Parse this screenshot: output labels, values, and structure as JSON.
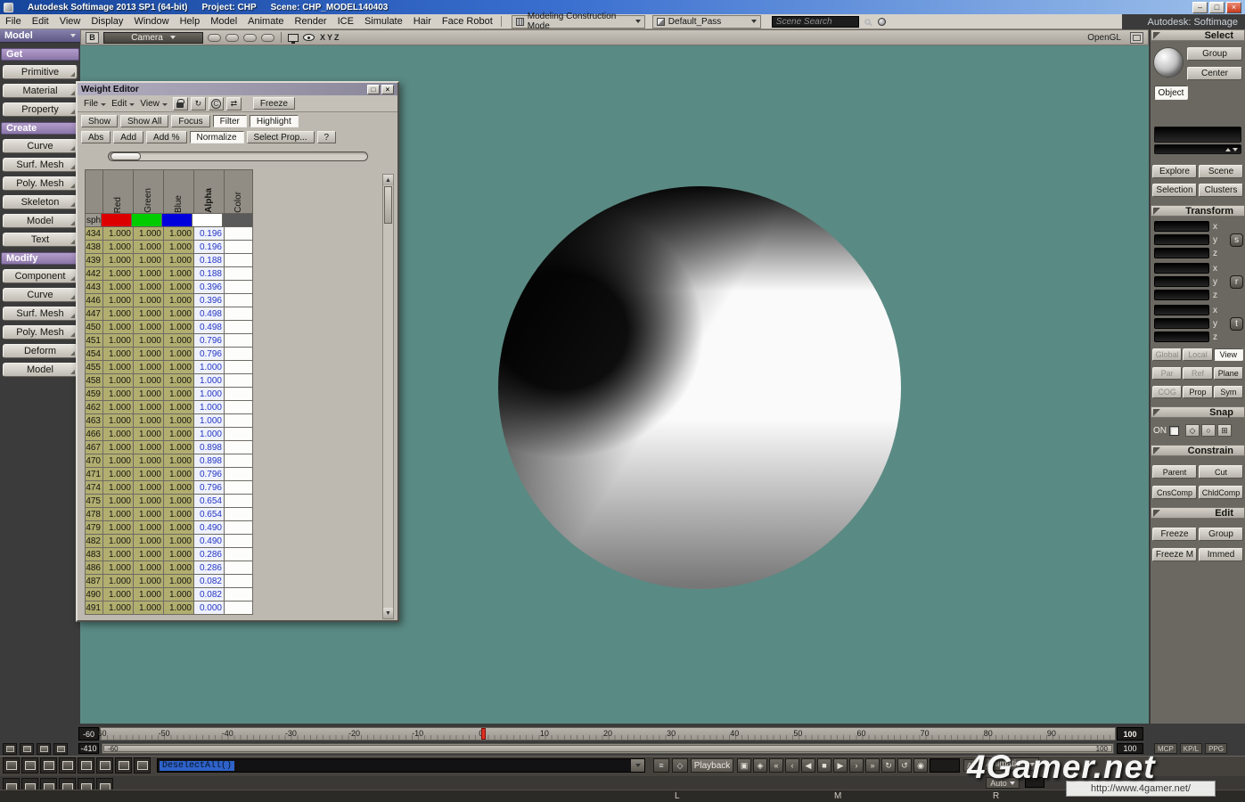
{
  "titlebar": {
    "title": "Autodesk Softimage 2013 SP1 (64-bit)",
    "project": "Project: CHP",
    "scene": "Scene: CHP_MODEL140403",
    "window_buttons": [
      {
        "g": "–",
        "n": "minimize-button"
      },
      {
        "g": "□",
        "n": "maximize-button"
      },
      {
        "g": "×",
        "n": "close-button",
        "cls": "close"
      }
    ]
  },
  "menubar": {
    "items": [
      "File",
      "Edit",
      "View",
      "Display",
      "Window",
      "Help",
      "Model",
      "Animate",
      "Render",
      "ICE",
      "Simulate",
      "Hair",
      "Face Robot"
    ],
    "construction_mode": "Modeling Construction Mode",
    "pass": "Default_Pass",
    "search_text": "Scene Search",
    "brand": "Autodesk: Softimage"
  },
  "left_panel": {
    "mode": "Model",
    "get_header": "Get",
    "get_items": [
      "Primitive",
      "Material",
      "Property"
    ],
    "create_header": "Create",
    "create_items": [
      "Curve",
      "Surf. Mesh",
      "Poly. Mesh",
      "Skeleton",
      "Model",
      "Text"
    ],
    "modify_header": "Modify",
    "modify_items": [
      "Component",
      "Curve",
      "Surf. Mesh",
      "Poly. Mesh",
      "Deform",
      "Model"
    ]
  },
  "viewport": {
    "pane_letter": "B",
    "camera": "Camera",
    "axes": [
      "X",
      "Y",
      "Z"
    ],
    "renderer": "OpenGL"
  },
  "weight_editor": {
    "title": "Weight Editor",
    "window_buttons": [
      {
        "g": "□",
        "n": "restore-button"
      },
      {
        "g": "×",
        "n": "close-button"
      }
    ],
    "menus": [
      "File",
      "Edit",
      "View"
    ],
    "glyphs": {
      "refresh": "↻",
      "swap": "⇄",
      "c_badge": "C",
      "up": "▲",
      "down": "▼"
    },
    "freeze": "Freeze",
    "toggles": [
      {
        "label": "Show"
      },
      {
        "label": "Show All"
      },
      {
        "label": "Focus"
      },
      {
        "label": "Filter",
        "cls": "active"
      },
      {
        "label": "Highlight",
        "cls": "active"
      }
    ],
    "modes": [
      {
        "label": "Abs"
      },
      {
        "label": "Add"
      },
      {
        "label": "Add %"
      },
      {
        "label": "Normalize",
        "cls": "active"
      },
      {
        "label": "Select Prop..."
      },
      {
        "label": "?"
      }
    ],
    "columns": [
      "Red",
      "Green",
      "Blue",
      "Alpha",
      "Color"
    ],
    "object_name": "sphe",
    "swatches": [
      "#dd0000",
      "#00cc00",
      "#0000dd",
      "#ffffff",
      "#5a5a5a"
    ],
    "rows": [
      [
        "434",
        "1.000",
        "1.000",
        "1.000",
        "0.196"
      ],
      [
        "438",
        "1.000",
        "1.000",
        "1.000",
        "0.196"
      ],
      [
        "439",
        "1.000",
        "1.000",
        "1.000",
        "0.188"
      ],
      [
        "442",
        "1.000",
        "1.000",
        "1.000",
        "0.188"
      ],
      [
        "443",
        "1.000",
        "1.000",
        "1.000",
        "0.396"
      ],
      [
        "446",
        "1.000",
        "1.000",
        "1.000",
        "0.396"
      ],
      [
        "447",
        "1.000",
        "1.000",
        "1.000",
        "0.498"
      ],
      [
        "450",
        "1.000",
        "1.000",
        "1.000",
        "0.498"
      ],
      [
        "451",
        "1.000",
        "1.000",
        "1.000",
        "0.796"
      ],
      [
        "454",
        "1.000",
        "1.000",
        "1.000",
        "0.796"
      ],
      [
        "455",
        "1.000",
        "1.000",
        "1.000",
        "1.000"
      ],
      [
        "458",
        "1.000",
        "1.000",
        "1.000",
        "1.000"
      ],
      [
        "459",
        "1.000",
        "1.000",
        "1.000",
        "1.000"
      ],
      [
        "462",
        "1.000",
        "1.000",
        "1.000",
        "1.000"
      ],
      [
        "463",
        "1.000",
        "1.000",
        "1.000",
        "1.000"
      ],
      [
        "466",
        "1.000",
        "1.000",
        "1.000",
        "1.000"
      ],
      [
        "467",
        "1.000",
        "1.000",
        "1.000",
        "0.898"
      ],
      [
        "470",
        "1.000",
        "1.000",
        "1.000",
        "0.898"
      ],
      [
        "471",
        "1.000",
        "1.000",
        "1.000",
        "0.796"
      ],
      [
        "474",
        "1.000",
        "1.000",
        "1.000",
        "0.796"
      ],
      [
        "475",
        "1.000",
        "1.000",
        "1.000",
        "0.654"
      ],
      [
        "478",
        "1.000",
        "1.000",
        "1.000",
        "0.654"
      ],
      [
        "479",
        "1.000",
        "1.000",
        "1.000",
        "0.490"
      ],
      [
        "482",
        "1.000",
        "1.000",
        "1.000",
        "0.490"
      ],
      [
        "483",
        "1.000",
        "1.000",
        "1.000",
        "0.286"
      ],
      [
        "486",
        "1.000",
        "1.000",
        "1.000",
        "0.286"
      ],
      [
        "487",
        "1.000",
        "1.000",
        "1.000",
        "0.082"
      ],
      [
        "490",
        "1.000",
        "1.000",
        "1.000",
        "0.082"
      ],
      [
        "491",
        "1.000",
        "1.000",
        "1.000",
        "0.000"
      ]
    ]
  },
  "right_panel": {
    "select_header": "Select",
    "group": "Group",
    "center": "Center",
    "object": "Object",
    "explore": "Explore",
    "scene": "Scene",
    "selection": "Selection",
    "clusters": "Clusters",
    "transform_header": "Transform",
    "transform_clusters": [
      {
        "axes": [
          "x",
          "y",
          "z"
        ],
        "btn": "s"
      },
      {
        "axes": [
          "x",
          "y",
          "z"
        ],
        "btn": "r"
      },
      {
        "axes": [
          "x",
          "y",
          "z"
        ],
        "btn": "t"
      }
    ],
    "space_buttons": [
      {
        "label": "Global",
        "cls": "disabled"
      },
      {
        "label": "Local",
        "cls": "disabled"
      },
      {
        "label": "View",
        "cls": "active"
      }
    ],
    "ref_buttons": [
      {
        "label": "Par",
        "cls": "disabled"
      },
      {
        "label": "Ref",
        "cls": "disabled"
      },
      {
        "label": "Plane"
      }
    ],
    "extra_buttons": [
      {
        "label": "COG",
        "cls": "disabled"
      },
      {
        "label": "Prop"
      },
      {
        "label": "Sym"
      }
    ],
    "snap_header": "Snap",
    "snap_on": "ON",
    "snap_icons": [
      {
        "g": "◇",
        "n": "snap-point-icon"
      },
      {
        "g": "○",
        "n": "snap-curve-icon"
      },
      {
        "g": "⊞",
        "n": "snap-grid-icon"
      }
    ],
    "constrain_header": "Constrain",
    "constrain_buttons": [
      {
        "label": "Parent"
      },
      {
        "label": "Cut"
      },
      {
        "label": "CnsComp"
      },
      {
        "label": "ChldComp"
      }
    ],
    "edit_header": "Edit",
    "edit_buttons": [
      {
        "label": "Freeze"
      },
      {
        "label": "Group"
      },
      {
        "label": "Freeze M"
      },
      {
        "label": "Immed"
      }
    ]
  },
  "timeline": {
    "start_frame": "-60",
    "end_frame": "100",
    "ticks": [
      "-60",
      "-50",
      "-40",
      "-30",
      "-20",
      "-10",
      "0",
      "10",
      "20",
      "30",
      "40",
      "50",
      "60",
      "70",
      "80",
      "90"
    ],
    "current_frame": "0",
    "offset_field": "-410",
    "range_start": "-60",
    "range_end": "100",
    "range_box": "100",
    "mini_buttons": [
      "MCP",
      "KP/L",
      "PPG"
    ]
  },
  "bottom": {
    "script_text": "DeselectAll()",
    "playback": "Playback",
    "transport": [
      {
        "g": "▣",
        "n": "frame-toggle-button"
      },
      {
        "g": "◈",
        "n": "key-toggle-button"
      },
      {
        "g": "«",
        "n": "first-frame-button"
      },
      {
        "g": "‹",
        "n": "previous-key-button"
      },
      {
        "g": "◀",
        "n": "previous-frame-button"
      },
      {
        "g": "■",
        "n": "stop-button"
      },
      {
        "g": "▶",
        "n": "play-button"
      },
      {
        "g": "›",
        "n": "next-key-button"
      },
      {
        "g": "»",
        "n": "last-frame-button"
      },
      {
        "g": "↻",
        "n": "loop-button"
      },
      {
        "g": "↺",
        "n": "play-backwards-button"
      },
      {
        "g": "◉",
        "n": "realtime-button"
      }
    ],
    "frame_value": "",
    "all_label": "All",
    "animation": "Animation",
    "auto": "Auto",
    "mouse_labels": [
      "L",
      "M",
      "R"
    ],
    "watermark": "4Gamer.net",
    "url": "http://www.4gamer.net/"
  },
  "tool_icons": {
    "range_left": [
      "select-tool-icon",
      "draw-keys-icon",
      "region-tool-icon",
      "grid-tool-icon"
    ],
    "layout_row1": [
      "layout-single-icon",
      "layout-double-icon",
      "layout-quad-icon",
      "layout-horizontal-icon",
      "layout-vertical-icon",
      "layout-preset-a-icon",
      "layout-preset-b-icon",
      "layout-preset-c-icon"
    ],
    "layout_row2": [
      "layout-preset-d-icon",
      "layout-preset-e-icon",
      "layout-preset-f-icon",
      "layout-preset-g-icon",
      "layout-preset-h-icon",
      "layout-preset-i-icon"
    ]
  }
}
